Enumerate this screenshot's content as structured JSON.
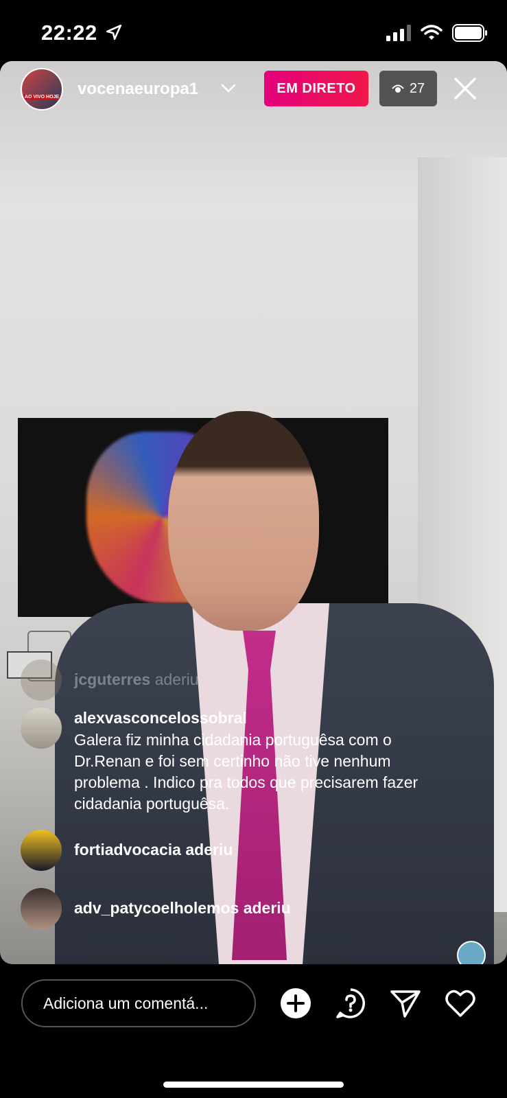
{
  "status_bar": {
    "time": "22:22",
    "icons": [
      "location-arrow-icon",
      "signal-icon",
      "wifi-icon",
      "battery-icon"
    ]
  },
  "live_header": {
    "avatar_text": "AO VIVO HOJE",
    "username": "vocenaeuropa1",
    "live_badge": "EM DIRETO",
    "viewer_count": "27"
  },
  "comments": [
    {
      "username": "jcguterres",
      "text": "aderiu",
      "faded": true
    },
    {
      "username": "alexvasconcelossobral",
      "text": "Galera fiz minha cidadania portuguêsa com o Dr.Renan e foi sem certinho não tive nenhum problema . Indico pra todos que precisarem fazer cidadania portuguêsa."
    },
    {
      "username": "fortiadvocacia",
      "text": "aderiu"
    },
    {
      "username": "adv_patycoelholemos",
      "text": "aderiu"
    }
  ],
  "bottom_bar": {
    "comment_placeholder": "Adiciona um comentá...",
    "icons": [
      "add-icon",
      "question-icon",
      "send-icon",
      "heart-icon"
    ]
  },
  "colors": {
    "live_badge": "#e4007c",
    "background": "#000000"
  }
}
